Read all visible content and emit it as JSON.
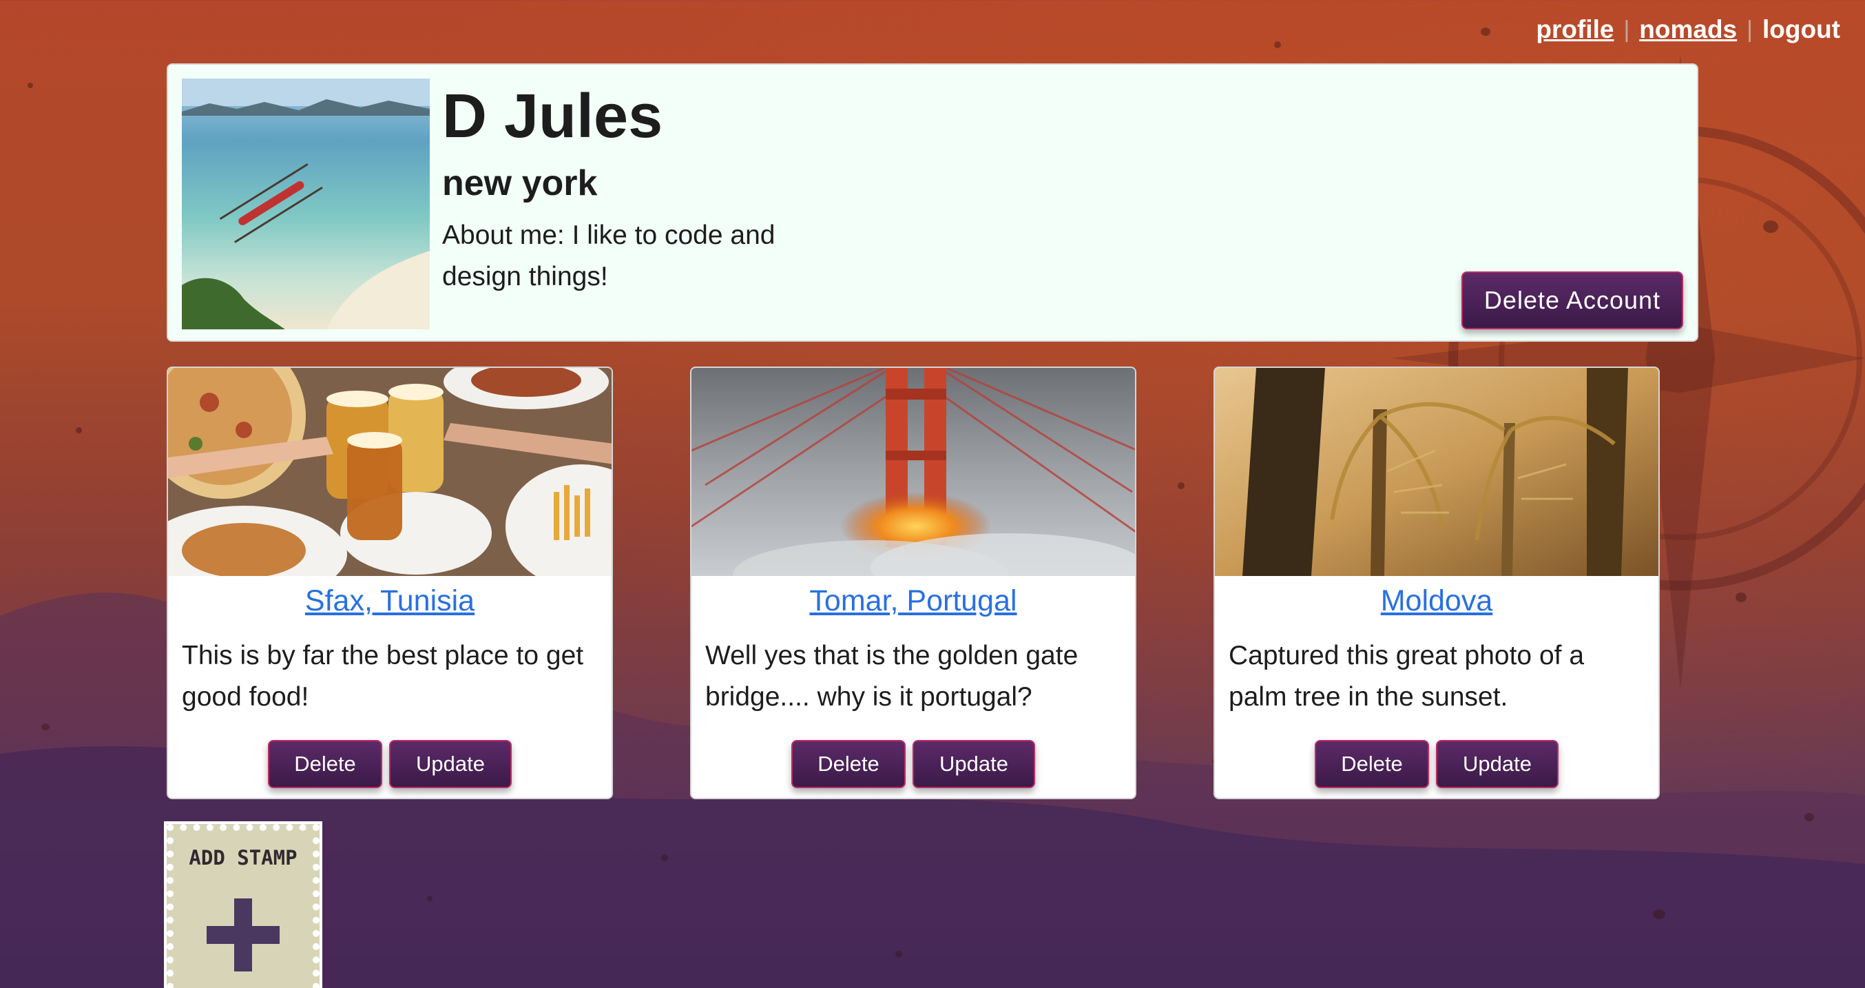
{
  "nav": {
    "profile": "profile",
    "nomads": "nomads",
    "logout": "logout",
    "separator": "|"
  },
  "profile": {
    "name": "D Jules",
    "city": "new york",
    "about": "About me: I like to code and design things!",
    "delete_account_label": "Delete Account"
  },
  "stamps": [
    {
      "title": "Sfax, Tunisia",
      "description": "This is by far the best place to get good food!",
      "delete_label": "Delete",
      "update_label": "Update"
    },
    {
      "title": "Tomar, Portugal",
      "description": "Well yes that is the golden gate bridge.... why is it portugal?",
      "delete_label": "Delete",
      "update_label": "Update"
    },
    {
      "title": "Moldova",
      "description": "Captured this great photo of a palm tree in the sunset.",
      "delete_label": "Delete",
      "update_label": "Update"
    }
  ],
  "add_stamp": {
    "label": "ADD STAMP",
    "icon": "plus-icon"
  },
  "colors": {
    "button": "#4a2155",
    "button_border": "#c02a63",
    "link": "#2970e0",
    "profile_bg": "#f3fff9"
  }
}
